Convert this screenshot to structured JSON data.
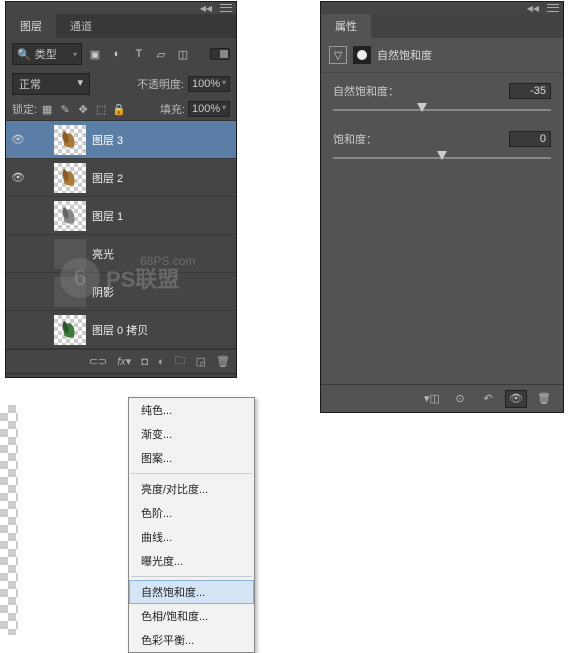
{
  "layers_panel": {
    "tabs": [
      {
        "label": "图层",
        "active": true
      },
      {
        "label": "通道",
        "active": false
      }
    ],
    "filter": {
      "search_icon": "🔍",
      "type_label": "类型"
    },
    "blend_mode": "正常",
    "opacity_label": "不透明度:",
    "opacity_value": "100%",
    "lock_label": "锁定:",
    "fill_label": "填充:",
    "fill_value": "100%",
    "layers": [
      {
        "name": "图层 3",
        "visible": true,
        "selected": true,
        "thumb": "leaf-brown"
      },
      {
        "name": "图层 2",
        "visible": true,
        "selected": false,
        "thumb": "leaf-brown"
      },
      {
        "name": "图层 1",
        "visible": false,
        "selected": false,
        "thumb": "leaf-gray"
      },
      {
        "name": "亮光",
        "visible": false,
        "selected": false,
        "thumb": "dark"
      },
      {
        "name": "阴影",
        "visible": false,
        "selected": false,
        "thumb": "dark"
      },
      {
        "name": "图层 0 拷贝",
        "visible": false,
        "selected": false,
        "thumb": "leaf-green"
      }
    ]
  },
  "context_menu": {
    "items": [
      {
        "label": "纯色..."
      },
      {
        "label": "渐变..."
      },
      {
        "label": "图案..."
      },
      {
        "sep": true
      },
      {
        "label": "亮度/对比度..."
      },
      {
        "label": "色阶..."
      },
      {
        "label": "曲线..."
      },
      {
        "label": "曝光度..."
      },
      {
        "sep": true
      },
      {
        "label": "自然饱和度...",
        "highlighted": true
      },
      {
        "label": "色相/饱和度..."
      },
      {
        "label": "色彩平衡..."
      }
    ]
  },
  "properties_panel": {
    "tab": "属性",
    "title": "自然饱和度",
    "sliders": [
      {
        "label": "自然饱和度：",
        "value": "-35",
        "pos": 41
      },
      {
        "label": "饱和度：",
        "value": "0",
        "pos": 50
      }
    ]
  },
  "watermark": {
    "brand": "PS联盟",
    "url": "68PS.com"
  }
}
